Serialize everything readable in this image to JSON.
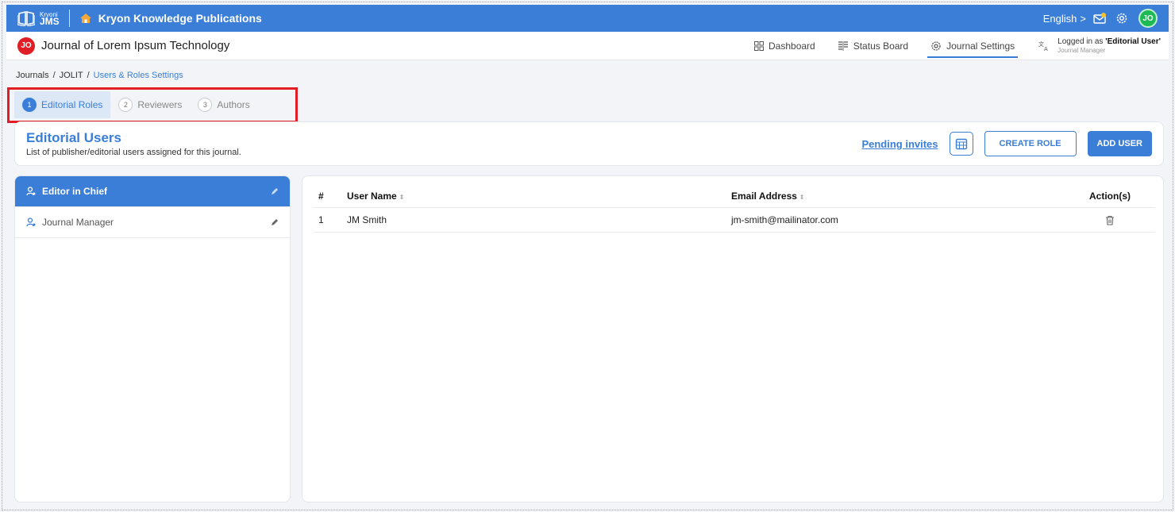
{
  "topbar": {
    "brand_small": "Kryoni",
    "brand_big": "JMS",
    "org_name": "Kryon Knowledge Publications",
    "language": "English",
    "language_chevron": ">",
    "user_initials": "JO",
    "icons": [
      "book-logo-icon",
      "home-icon",
      "mail-icon",
      "gear-icon"
    ]
  },
  "journal_bar": {
    "initials": "JO",
    "title": "Journal of Lorem Ipsum Technology",
    "nav": [
      {
        "label": "Dashboard",
        "icon": "grid-icon"
      },
      {
        "label": "Status Board",
        "icon": "board-icon"
      },
      {
        "label": "Journal Settings",
        "icon": "settings-icon",
        "active": true
      }
    ],
    "login_prefix": "Logged in as",
    "login_user": "'Editorial User'",
    "login_role": "Journal Manager"
  },
  "breadcrumb": {
    "items": [
      "Journals",
      "JOLIT",
      "Users & Roles Settings"
    ],
    "separator": "/"
  },
  "steps": [
    {
      "num": "1",
      "label": "Editorial Roles",
      "active": true
    },
    {
      "num": "2",
      "label": "Reviewers"
    },
    {
      "num": "3",
      "label": "Authors"
    }
  ],
  "header": {
    "title": "Editorial Users",
    "subtitle": "List of publisher/editorial users assigned for this journal.",
    "pending_invites": "Pending invites",
    "create_role": "CREATE ROLE",
    "add_user": "ADD USER"
  },
  "roles": [
    {
      "label": "Editor in Chief",
      "active": true
    },
    {
      "label": "Journal Manager"
    }
  ],
  "table": {
    "columns": [
      "#",
      "User Name",
      "Email Address",
      "Action(s)"
    ],
    "sort_glyph": "⇕",
    "rows": [
      {
        "num": "1",
        "name": "JM Smith",
        "email": "jm-smith@mailinator.com"
      }
    ]
  },
  "colors": {
    "primary": "#3a7ed8",
    "highlight": "#e11d25",
    "avatar_green": "#1db954"
  }
}
